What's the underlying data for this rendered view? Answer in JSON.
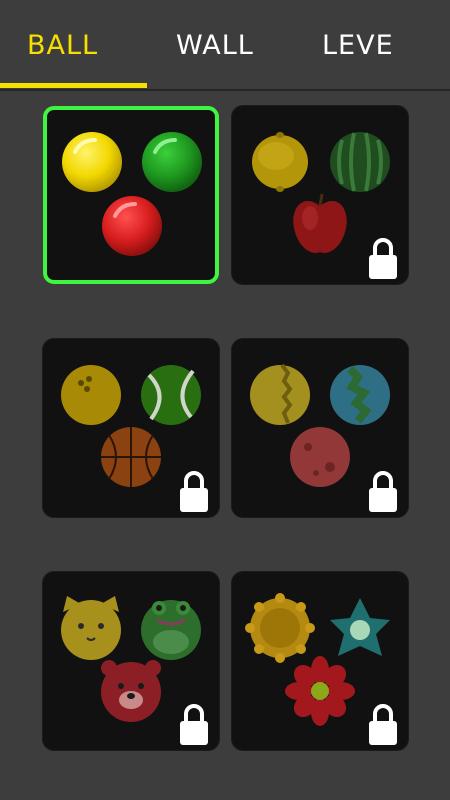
{
  "tabs": [
    {
      "label": "BALL",
      "active": true
    },
    {
      "label": "WALL",
      "active": false
    },
    {
      "label": "LEVE",
      "active": false
    }
  ],
  "colors": {
    "accent": "#f5e000",
    "selected_border": "#3ff53f",
    "background": "#3d3d3d",
    "card": "#111111"
  },
  "skins": [
    {
      "name": "classic-balls",
      "balls": [
        "yellow-ball",
        "green-ball",
        "red-ball"
      ],
      "selected": true,
      "locked": false
    },
    {
      "name": "fruit-balls",
      "balls": [
        "lemon",
        "watermelon",
        "apple"
      ],
      "selected": false,
      "locked": true,
      "icon": "lock-icon"
    },
    {
      "name": "sport-balls",
      "balls": [
        "bowling-ball",
        "tennis-ball",
        "basketball"
      ],
      "selected": false,
      "locked": true,
      "icon": "lock-icon"
    },
    {
      "name": "planet-balls",
      "balls": [
        "venus",
        "earth",
        "mars"
      ],
      "selected": false,
      "locked": true,
      "icon": "lock-icon"
    },
    {
      "name": "animal-balls",
      "balls": [
        "cat",
        "frog",
        "bear"
      ],
      "selected": false,
      "locked": true,
      "icon": "lock-icon"
    },
    {
      "name": "flower-balls",
      "balls": [
        "sunflower",
        "teal-flower",
        "red-flower"
      ],
      "selected": false,
      "locked": true,
      "icon": "lock-icon"
    }
  ]
}
